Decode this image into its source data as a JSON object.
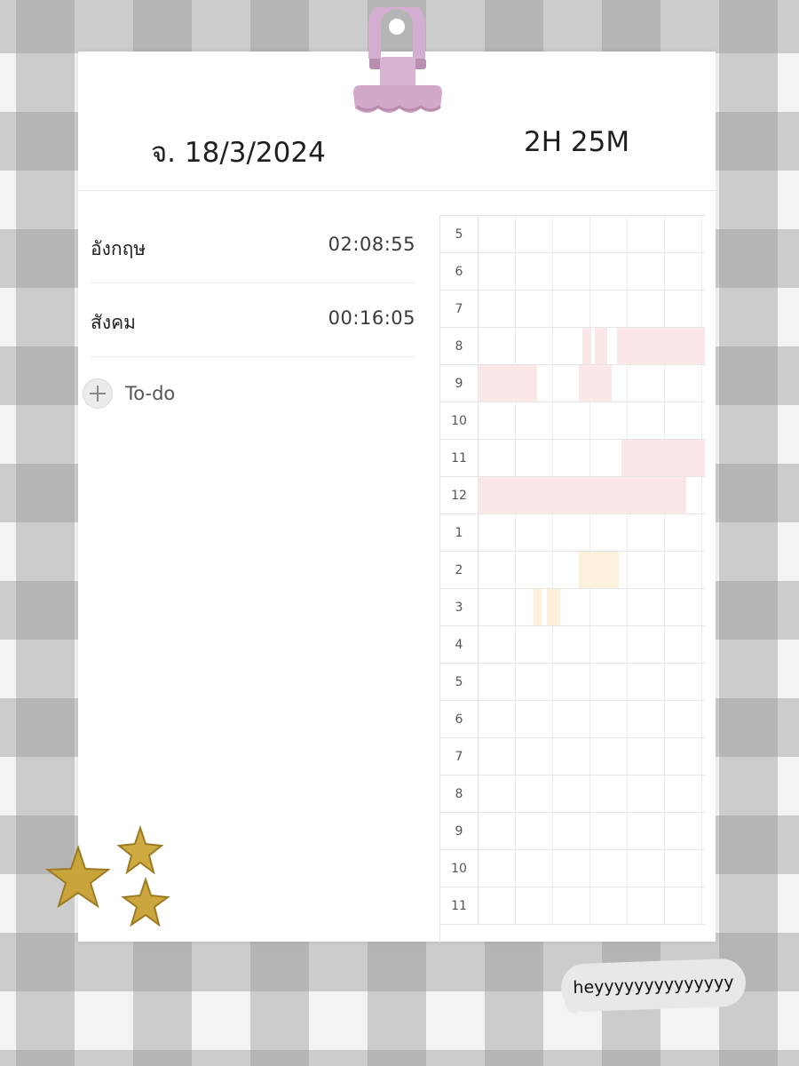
{
  "header": {
    "date": "จ. 18/3/2024",
    "total_time": "2H 25M"
  },
  "subjects": [
    {
      "name": "อังกฤษ",
      "time": "02:08:55"
    },
    {
      "name": "สังคม",
      "time": "00:16:05"
    }
  ],
  "todo": {
    "label": "To-do"
  },
  "timetable": {
    "hours": [
      "5",
      "6",
      "7",
      "8",
      "9",
      "10",
      "11",
      "12",
      "1",
      "2",
      "3",
      "4",
      "5",
      "6",
      "7",
      "8",
      "9",
      "10",
      "11"
    ],
    "colors": {
      "subject1": "#fbe6e8",
      "subject2": "#fdf1db"
    }
  },
  "bubble": {
    "text": "heyyyyyyyyyyyyyy"
  }
}
